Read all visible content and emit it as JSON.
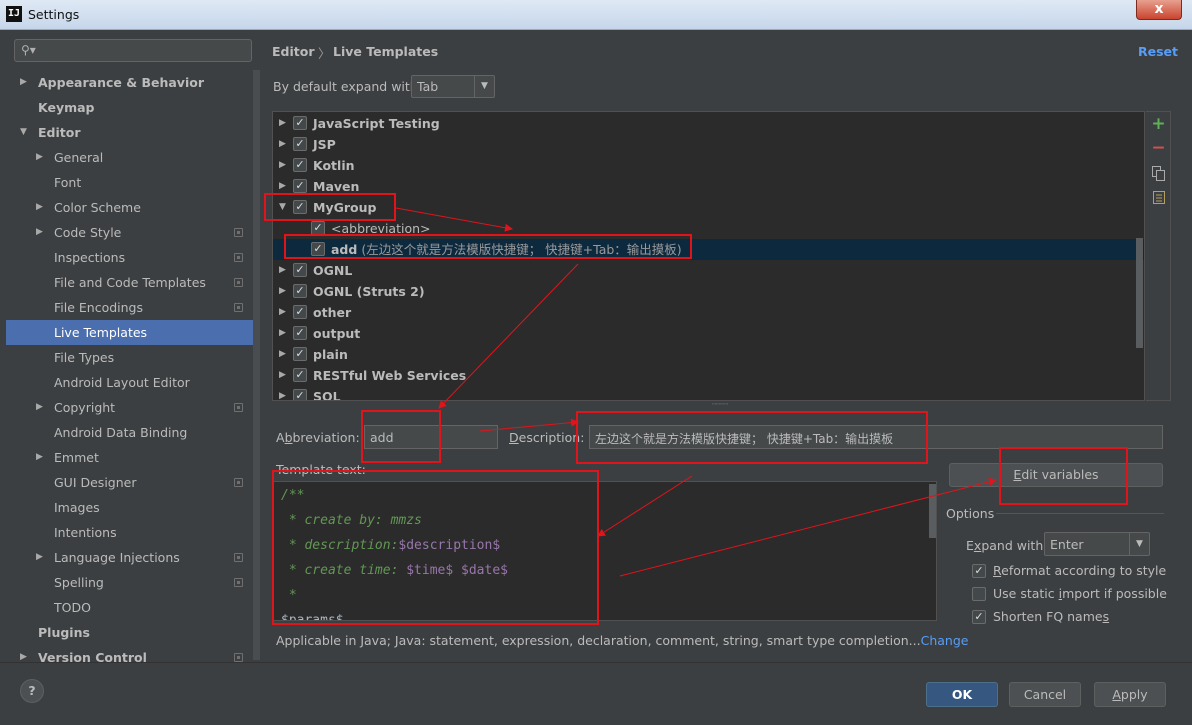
{
  "window": {
    "title": "Settings",
    "app_icon": "IJ",
    "close": "x"
  },
  "search": {
    "placeholder": "",
    "icon": "search-icon"
  },
  "sidebar": {
    "items": [
      {
        "label": "Appearance & Behavior",
        "bold": true,
        "arrow": "right"
      },
      {
        "label": "Keymap",
        "bold": true
      },
      {
        "label": "Editor",
        "bold": true,
        "arrow": "down"
      },
      {
        "label": "General",
        "arrow": "right"
      },
      {
        "label": "Font"
      },
      {
        "label": "Color Scheme",
        "arrow": "right"
      },
      {
        "label": "Code Style",
        "arrow": "right",
        "project_icon": true
      },
      {
        "label": "Inspections",
        "project_icon": true
      },
      {
        "label": "File and Code Templates",
        "project_icon": true
      },
      {
        "label": "File Encodings",
        "project_icon": true
      },
      {
        "label": "Live Templates",
        "selected": true
      },
      {
        "label": "File Types"
      },
      {
        "label": "Android Layout Editor"
      },
      {
        "label": "Copyright",
        "arrow": "right",
        "project_icon": true
      },
      {
        "label": "Android Data Binding"
      },
      {
        "label": "Emmet",
        "arrow": "right"
      },
      {
        "label": "GUI Designer",
        "project_icon": true
      },
      {
        "label": "Images"
      },
      {
        "label": "Intentions"
      },
      {
        "label": "Language Injections",
        "arrow": "right",
        "project_icon": true
      },
      {
        "label": "Spelling",
        "project_icon": true
      },
      {
        "label": "TODO"
      },
      {
        "label": "Plugins",
        "bold": true
      },
      {
        "label": "Version Control",
        "bold": true,
        "arrow": "right",
        "project_icon": true
      }
    ]
  },
  "breadcrumb": {
    "parent": "Editor",
    "separator": "〉",
    "current": "Live Templates"
  },
  "reset_label": "Reset",
  "expand_default": {
    "label": "By default expand with",
    "value": "Tab"
  },
  "templates": {
    "groups_before": [
      "JavaScript Testing",
      "JSP",
      "Kotlin",
      "Maven"
    ],
    "open_group": "MyGroup",
    "children": [
      {
        "abbr": "<abbreviation>",
        "desc": ""
      },
      {
        "abbr": "add",
        "desc": "(左边这个就是方法模版快捷键； 快捷键+Tab：输出摸板)"
      }
    ],
    "groups_after": [
      "OGNL",
      "OGNL (Struts 2)",
      "other",
      "output",
      "plain",
      "RESTful Web Services",
      "SQL"
    ]
  },
  "toolbar": {
    "add": "+",
    "remove": "−",
    "copy": "copy-icon",
    "move": "list-icon"
  },
  "abbreviation": {
    "label": "Abbreviation:",
    "value": "add"
  },
  "description": {
    "label": "Description:",
    "value": "左边这个就是方法模版快捷键； 快捷键+Tab：输出摸板"
  },
  "template_text": {
    "label": "Template text:",
    "lines": [
      {
        "c": "/**"
      },
      {
        "c": " * create by: mmzs"
      },
      {
        "c": " * description:",
        "v": "$description$"
      },
      {
        "c": " * create time: ",
        "v": "$time$ $date$"
      },
      {
        "c": " *"
      },
      {
        "c": "",
        "w": "$params$"
      }
    ]
  },
  "edit_variables": "Edit variables",
  "options": {
    "label": "Options",
    "expand_with_label": "Expand with",
    "expand_with_value": "Enter",
    "reformat": "Reformat according to style",
    "static_import": "Use static import if possible",
    "shorten_fq": "Shorten FQ names"
  },
  "applicable": {
    "text": "Applicable in Java; Java: statement, expression, declaration, comment, string, smart type completion...",
    "link": "Change"
  },
  "buttons": {
    "help": "?",
    "ok": "OK",
    "cancel": "Cancel",
    "apply": "Apply"
  },
  "colors": {
    "accent": "#4b6eaf",
    "link": "#589df6",
    "annotation": "#e0141b",
    "background": "#3c3f41"
  }
}
